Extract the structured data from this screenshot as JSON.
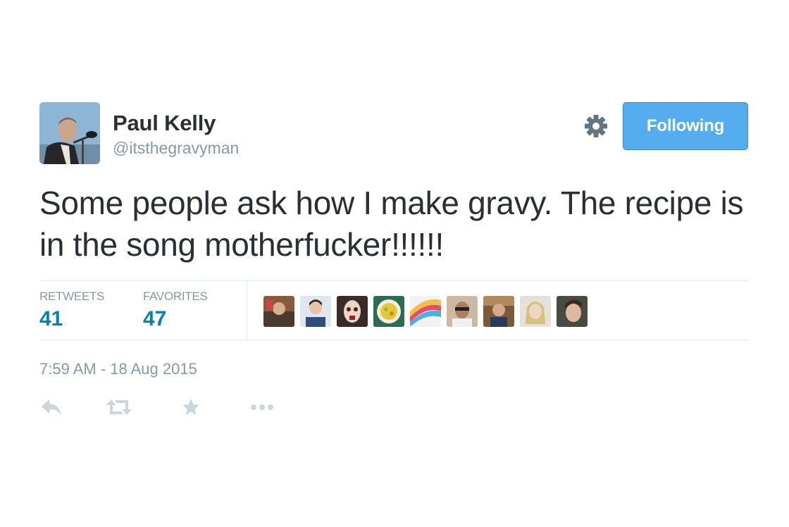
{
  "tweet": {
    "author_name": "Paul Kelly",
    "author_handle": "@itsthegravyman",
    "follow_label": "Following",
    "text": "Some people ask how I make gravy. The recipe is in the song motherfucker!!!!!!",
    "timestamp": "7:59 AM - 18 Aug 2015"
  },
  "stats": {
    "retweets_label": "RETWEETS",
    "retweets_count": "41",
    "favorites_label": "FAVORITES",
    "favorites_count": "47"
  },
  "icons": {
    "settings": "gear-icon",
    "reply": "reply-icon",
    "retweet": "retweet-icon",
    "favorite": "star-icon",
    "more": "more-icon"
  },
  "colors": {
    "accent": "#55acee",
    "stat_value": "#0084b4",
    "muted": "#8899a6",
    "text": "#292f33",
    "divider": "#e1e8ed"
  }
}
